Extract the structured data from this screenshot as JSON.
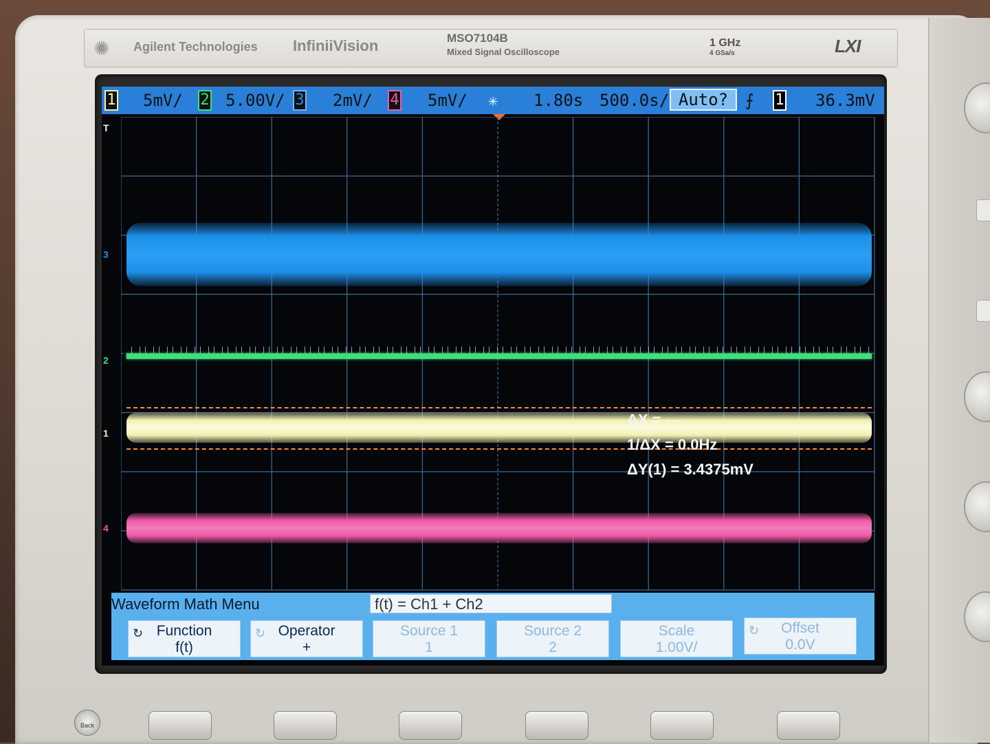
{
  "header": {
    "brand": "Agilent Technologies",
    "series": "InfiniiVision",
    "model": "MSO7104B",
    "model_desc": "Mixed Signal Oscilloscope",
    "bandwidth": "1 GHz",
    "sample_rate": "4 GSa/s",
    "lxi": "LXI"
  },
  "status": {
    "ch1_num": "1",
    "ch1_scale": "5mV/",
    "ch2_num": "2",
    "ch2_scale": "5.00V/",
    "ch3_num": "3",
    "ch3_scale": "2mV/",
    "ch4_num": "4",
    "ch4_scale": "5mV/",
    "time_delay": "1.80s",
    "time_scale": "500.0s/",
    "trigger_mode": "Auto?",
    "trigger_source": "1",
    "trigger_level": "36.3mV"
  },
  "colors": {
    "ch1": "#f2f0b0",
    "ch2": "#3ee07a",
    "ch3": "#1e8fe8",
    "ch4": "#ef5aa8",
    "statusbar": "#2a7fd8",
    "menu": "#5ab0ec"
  },
  "markers": {
    "ch1": "1",
    "ch2": "2",
    "ch3": "3",
    "ch4": "4",
    "trigger": "T"
  },
  "readouts": {
    "dx": "ΔX = ---",
    "inv_dx": "1/ΔX = 0.0Hz",
    "dy": "ΔY(1) = 3.4375mV"
  },
  "menu": {
    "title": "Waveform Math Menu",
    "expression": "f(t) = Ch1 + Ch2",
    "softkeys": [
      {
        "title": "Function",
        "value": "f(t)"
      },
      {
        "title": "Operator",
        "value": "+"
      },
      {
        "title": "Source 1",
        "value": "1"
      },
      {
        "title": "Source 2",
        "value": "2"
      },
      {
        "title": "Scale",
        "value": "1.00V/"
      },
      {
        "title": "Offset",
        "value": "0.0V"
      }
    ]
  },
  "front_panel": {
    "back_label": "Back"
  }
}
